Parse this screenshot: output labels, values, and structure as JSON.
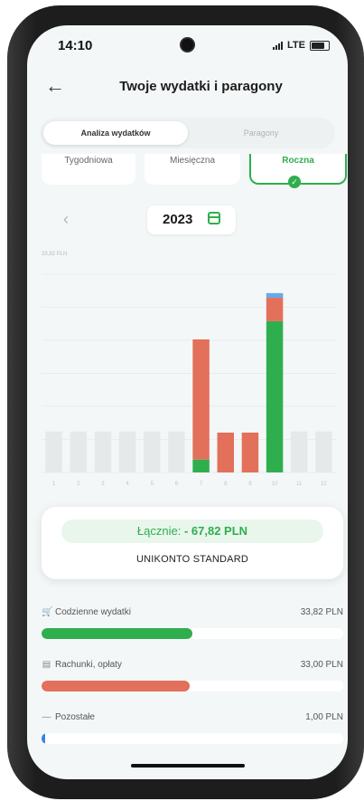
{
  "status": {
    "time": "14:10",
    "network": "LTE"
  },
  "header": {
    "title": "Twoje wydatki i paragony",
    "back_icon": "arrow-left-icon"
  },
  "tabs": [
    {
      "label": "Analiza wydatków",
      "active": true
    },
    {
      "label": "Paragony",
      "active": false
    }
  ],
  "periods": [
    {
      "label": "Tygodniowa",
      "active": false
    },
    {
      "label": "Miesięczna",
      "active": false
    },
    {
      "label": "Roczna",
      "active": true
    }
  ],
  "year_selector": {
    "year": "2023",
    "prev_icon": "chevron-left-icon",
    "calendar_icon": "calendar-icon"
  },
  "chart_data": {
    "type": "bar",
    "stacked": true,
    "max_label": "33,82 PLN",
    "categories": [
      "1",
      "2",
      "3",
      "4",
      "5",
      "6",
      "7",
      "8",
      "9",
      "10",
      "11",
      "12"
    ],
    "ylim": [
      0,
      33.82
    ],
    "series": [
      {
        "color": "#2fae4e",
        "values": [
          0,
          0,
          0,
          0,
          0,
          0,
          2.2,
          0,
          0,
          25.8,
          0,
          0
        ]
      },
      {
        "color": "#e2705a",
        "values": [
          0,
          0,
          0,
          0,
          0,
          0,
          20.5,
          6.8,
          6.8,
          4.0,
          0,
          0
        ]
      },
      {
        "color": "#6aa7e8",
        "values": [
          0,
          0,
          0,
          0,
          0,
          0,
          0,
          0,
          0,
          0.8,
          0,
          0
        ]
      }
    ],
    "empty_bar_value": 7.0,
    "empty_color": "#e6e9e9"
  },
  "summary": {
    "total_label": "Łącznie:",
    "total_value": "- 67,82 PLN",
    "account": "UNIKONTO STANDARD"
  },
  "categories": [
    {
      "label": "Codzienne wydatki",
      "amount": "33,82 PLN",
      "icon": "cart-icon",
      "glyph": "🛒",
      "color": "#2fae4e",
      "fraction": 0.5
    },
    {
      "label": "Rachunki, opłaty",
      "amount": "33,00 PLN",
      "icon": "bill-icon",
      "glyph": "▤",
      "color": "#e2705a",
      "fraction": 0.49
    },
    {
      "label": "Pozostałe",
      "amount": "1,00 PLN",
      "icon": "dash-icon",
      "glyph": "—",
      "color": "#3b82e0",
      "fraction": 0.012
    }
  ]
}
